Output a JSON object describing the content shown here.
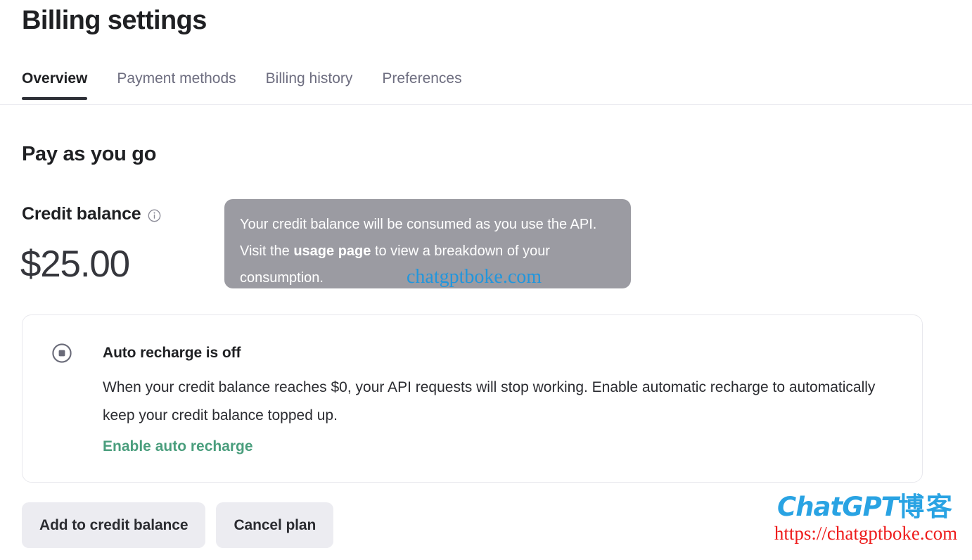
{
  "header": {
    "title": "Billing settings",
    "tabs": [
      {
        "label": "Overview",
        "active": true
      },
      {
        "label": "Payment methods",
        "active": false
      },
      {
        "label": "Billing history",
        "active": false
      },
      {
        "label": "Preferences",
        "active": false
      }
    ]
  },
  "main": {
    "section_title": "Pay as you go",
    "balance_label": "Credit balance",
    "balance_info_icon": "info-icon",
    "balance_amount": "$25.00",
    "tooltip": {
      "part1": "Your credit balance will be consumed as you use the API. Visit the ",
      "emphasis": "usage page",
      "part2": " to view a breakdown of your consumption."
    },
    "auto_recharge": {
      "status_icon": "stop-circle-icon",
      "heading": "Auto recharge is off",
      "description": "When your credit balance reaches $0, your API requests will stop working. Enable automatic recharge to automatically keep your credit balance topped up.",
      "link_label": "Enable auto recharge",
      "link_color": "#4a9e7d"
    },
    "buttons": [
      {
        "label": "Add to credit balance"
      },
      {
        "label": "Cancel plan"
      }
    ]
  },
  "watermarks": {
    "inline_text": "chatgptboke.com",
    "inline_color": "#2196dd",
    "logo_brand": "ChatGPT",
    "logo_cn": "博客",
    "logo_url": "https://chatgptboke.com",
    "logo_brand_color": "#29a3e3",
    "logo_url_color": "#ee1c1c"
  }
}
